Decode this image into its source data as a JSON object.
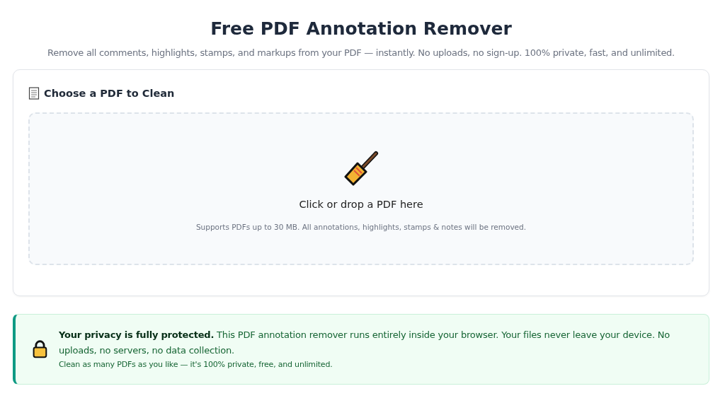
{
  "title": "Free PDF Annotation Remover",
  "subtitle": "Remove all comments, highlights, stamps, and markups from your PDF — instantly. No uploads, no sign-up. 100% private, fast, and unlimited.",
  "card": {
    "heading": "Choose a PDF to Clean",
    "dropzone": {
      "label": "Click or drop a PDF here",
      "hint": "Supports PDFs up to 30 MB. All annotations, highlights, stamps & notes will be removed."
    }
  },
  "privacy": {
    "text": "**Your privacy is fully protected.** This PDF annotation remover runs entirely inside your browser. Your files never leave your device. No uploads, no servers, no data collection.",
    "note": "Clean as many PDFs as you like — it's 100% private, free, and unlimited."
  }
}
